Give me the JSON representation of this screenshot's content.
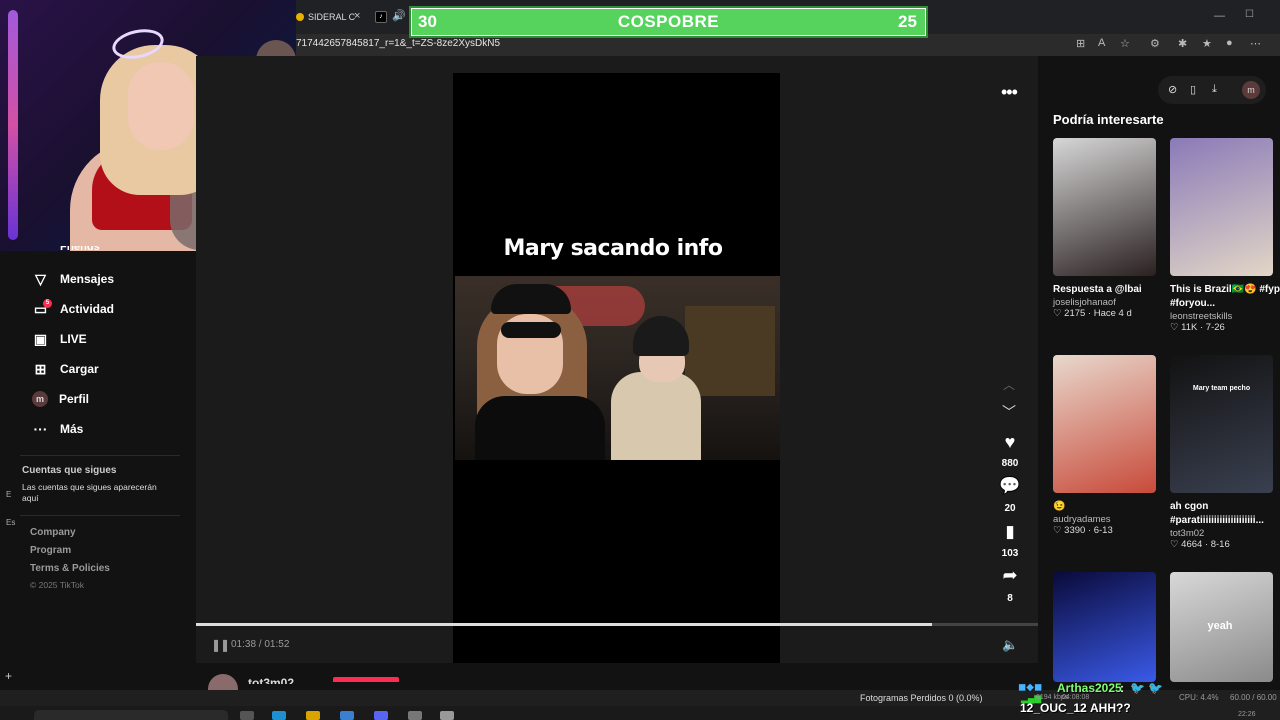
{
  "browser": {
    "tab_label": "SIDERAL C",
    "url": "717442657845817_r=1&_t=ZS-8ze2XysDkN5",
    "tab_close_icon": "×",
    "speaker_icon": "🔊",
    "minimize_icon": "—",
    "maximize_icon": "☐"
  },
  "overlay_goal": {
    "left_value": "30",
    "title": "COSPOBRE",
    "right_value": "25",
    "color": "#55d35c"
  },
  "sidebar": {
    "partial_item": "Friends",
    "items": [
      {
        "label": "Mensajes",
        "icon": "send-icon"
      },
      {
        "label": "Actividad",
        "icon": "activity-icon",
        "badge": "5"
      },
      {
        "label": "LIVE",
        "icon": "live-icon"
      },
      {
        "label": "Cargar",
        "icon": "upload-icon"
      },
      {
        "label": "Perfil",
        "icon": "profile-avatar",
        "avatar_letter": "m"
      },
      {
        "label": "Más",
        "icon": "more-icon"
      }
    ],
    "following_title": "Cuentas que sigues",
    "following_desc": "Las cuentas que sigues aparecerán aquí",
    "footer_links": [
      "Company",
      "Program",
      "Terms & Policies"
    ],
    "copyright": "© 2025 TikTok",
    "edge_letter_e": "Es",
    "edge_letter_d": "E"
  },
  "player": {
    "caption": "Mary sacando info",
    "time": "01:38 / 01:52",
    "progress": 0.874,
    "likes": "880",
    "comments": "20",
    "saves": "103",
    "shares": "8",
    "author": "tot3m02"
  },
  "right_panel": {
    "avatar_letter": "m",
    "title": "Podría interesarte",
    "cards": [
      {
        "title": "Respuesta a @lbai",
        "author": "joselisjohanaof",
        "stats": "♡ 2175 · Hace 4 d",
        "thumb_label": "",
        "colors": [
          "#d7d7d7",
          "#2a2020"
        ]
      },
      {
        "title": "This is Brazil🇧🇷😍 #fyp #foryou...",
        "author": "leonstreetskills",
        "stats": "♡ 11K · 7-26",
        "thumb_label": "",
        "colors": [
          "#8a7ab8",
          "#e2d6c6"
        ]
      },
      {
        "title": "😉",
        "author": "audryadames",
        "stats": "♡ 3390 · 6-13",
        "thumb_label": "",
        "colors": [
          "#e8d8cc",
          "#c84a3a"
        ]
      },
      {
        "title": "ah cgon #paratiiiiiiiiiiiiiiiiiiii...",
        "author": "tot3m02",
        "stats": "♡ 4664 · 8-16",
        "thumb_label": "Mary team pecho",
        "colors": [
          "#121212",
          "#3a4050"
        ]
      },
      {
        "title": "",
        "author": "",
        "stats": "",
        "thumb_label": "",
        "colors": [
          "#0a0a3a",
          "#3a5ae8"
        ]
      },
      {
        "title": "",
        "author": "",
        "stats": "",
        "thumb_label": "yeah",
        "colors": [
          "#d8d8d8",
          "#8a8a8a"
        ]
      }
    ]
  },
  "obs": {
    "dropped": "Fotogramas Perdidos 0 (0.0%)",
    "kbps": "6194 kbps",
    "stream_time": "04:08:08",
    "cpu": "CPU: 4.4%",
    "fps": "60.00 / 60.00",
    "clock": "22:26"
  },
  "chat": [
    {
      "user": "Arthas2025",
      "message": "",
      "color": "#7dff73"
    },
    {
      "user": "12_OUC_12",
      "message": "AHH??",
      "color": "#ffffff"
    }
  ]
}
